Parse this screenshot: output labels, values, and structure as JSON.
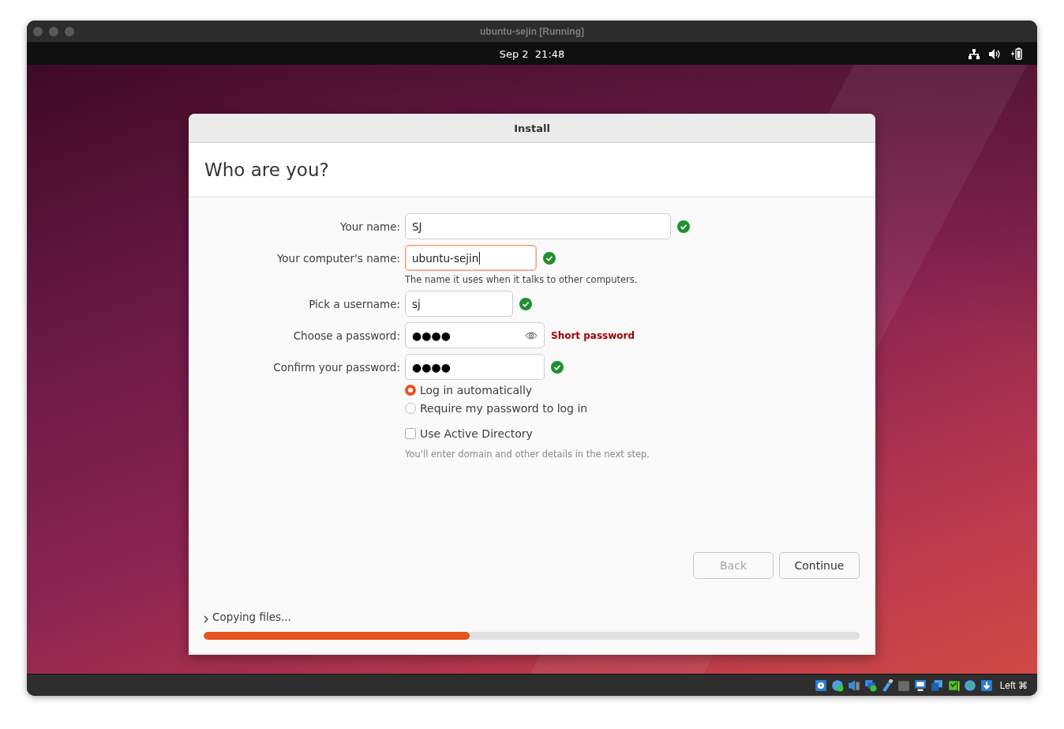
{
  "window": {
    "title": "ubuntu-sejin [Running]"
  },
  "top_bar": {
    "clock": "Sep 2  21:48"
  },
  "installer": {
    "title": "Install",
    "heading": "Who are you?",
    "fields": [
      {
        "label": "Your name:",
        "value": "SJ",
        "kind": "text",
        "focused": false,
        "valid": true
      },
      {
        "label": "Your computer's name:",
        "value": "ubuntu-sejin",
        "kind": "text",
        "focused": true,
        "valid": true,
        "hint": "The name it uses when it talks to other computers."
      },
      {
        "label": "Pick a username:",
        "value": "sj",
        "kind": "text",
        "focused": false,
        "valid": true
      },
      {
        "label": "Choose a password:",
        "value": "●●●●",
        "kind": "password",
        "focused": false,
        "valid": false,
        "message": "Short password"
      },
      {
        "label": "Confirm your password:",
        "value": "●●●●",
        "kind": "text",
        "focused": false,
        "valid": true
      }
    ],
    "login_options": [
      {
        "label": "Log in automatically",
        "selected": true
      },
      {
        "label": "Require my password to log in",
        "selected": false
      }
    ],
    "active_directory": {
      "label": "Use Active Directory",
      "checked": false,
      "hint": "You'll enter domain and other details in the next step."
    },
    "buttons": [
      {
        "label": "Back",
        "disabled": true
      },
      {
        "label": "Continue",
        "disabled": false
      }
    ],
    "progress": {
      "label": "Copying files...",
      "level": 0.405
    }
  },
  "status_bar": {
    "host_key": "Left ⌘"
  }
}
